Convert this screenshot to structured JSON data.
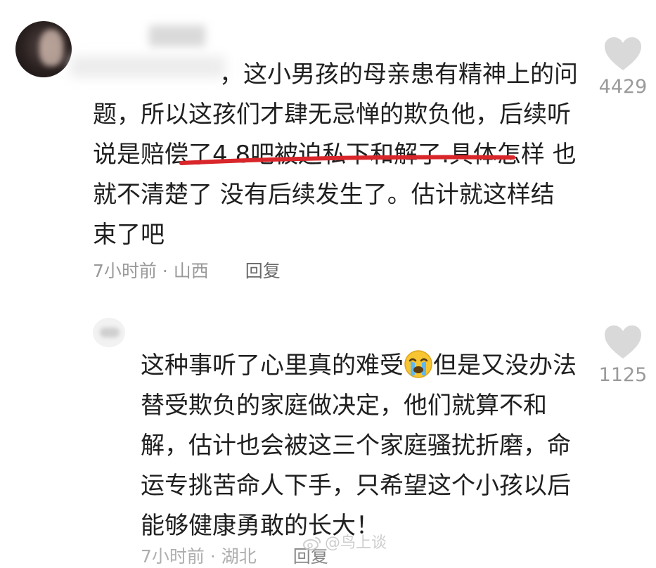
{
  "comments": [
    {
      "text": "，这小男孩的母亲患有精神上的问题，所以这孩们才肆无忌惮的欺负他，后续听说是赔偿了4.8吧被迫私下和解了.具体怎样 也就不清楚了 没有后续发生了。估计就这样结束了吧",
      "time": "7小时前",
      "separator": "·",
      "location": "山西",
      "reply_label": "回复",
      "likes": "4429"
    },
    {
      "text_before_emoji": "这种事听了心里真的难受",
      "emoji": "crying-face",
      "text_after_emoji": "但是又没办法替受欺负的家庭做决定，他们就算不和解，估计也会被这三个家庭骚扰折磨，命运专挑苦命人下手，只希望这个小孩以后能够健康勇敢的长大！",
      "time": "7小时前",
      "separator": "·",
      "location": "湖北",
      "reply_label": "回复",
      "likes": "1125"
    }
  ],
  "watermark": "@鸟上谈",
  "colors": {
    "text": "#1f1f1f",
    "meta": "#9a9a9a",
    "heart": "#d9d9d9",
    "underline": "#d9262b"
  }
}
